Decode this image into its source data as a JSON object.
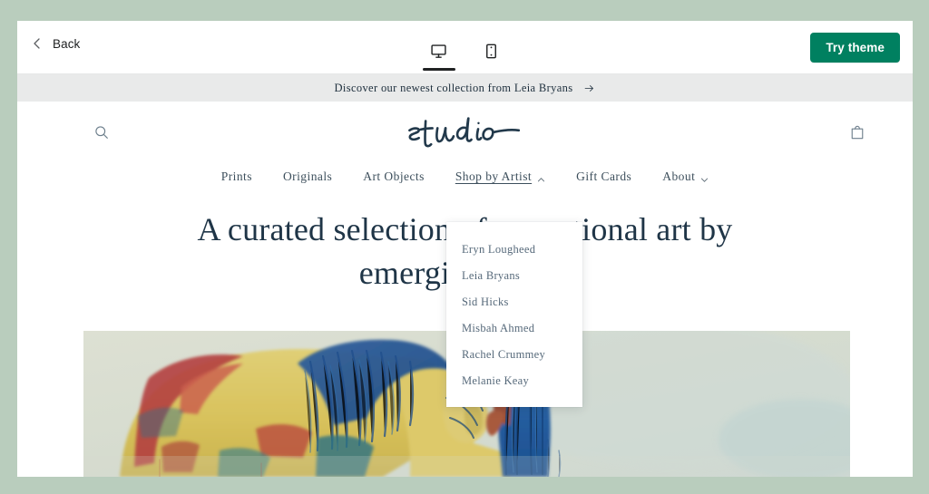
{
  "editor": {
    "back_label": "Back",
    "back_icon": "chevron-left-icon",
    "try_theme_label": "Try theme",
    "accent_color": "#008060",
    "devices": [
      {
        "name": "desktop",
        "icon": "desktop-icon",
        "selected": true
      },
      {
        "name": "mobile",
        "icon": "mobile-icon",
        "selected": false
      }
    ]
  },
  "storefront": {
    "background_color": "#ffffff",
    "stage_background_color": "#b9cdbd",
    "announcement": {
      "text": "Discover our newest collection from Leia Bryans",
      "icon": "arrow-right-icon",
      "background_color": "#e9eaea"
    },
    "header": {
      "logo_text": "studio",
      "search_icon": "search-icon",
      "cart_icon": "shopping-bag-icon"
    },
    "nav": [
      {
        "label": "Prints",
        "has_caret": false,
        "active": false
      },
      {
        "label": "Originals",
        "has_caret": false,
        "active": false
      },
      {
        "label": "Art Objects",
        "has_caret": false,
        "active": false
      },
      {
        "label": "Shop by Artist",
        "has_caret": true,
        "caret": "chevron-up-icon",
        "active": true
      },
      {
        "label": "Gift Cards",
        "has_caret": false,
        "active": false
      },
      {
        "label": "About",
        "has_caret": true,
        "caret": "chevron-down-icon",
        "active": false
      }
    ],
    "dropdown": {
      "open": true,
      "parent": "Shop by Artist",
      "items": [
        {
          "label": "Eryn Lougheed"
        },
        {
          "label": "Leia Bryans"
        },
        {
          "label": "Sid Hicks"
        },
        {
          "label": "Misbah Ahmed"
        },
        {
          "label": "Rachel Crummey"
        },
        {
          "label": "Melanie Keay"
        }
      ]
    },
    "hero": {
      "heading": "A curated selection of exceptional art by emerging artists",
      "heading_color": "#1f3547",
      "artwork_alt": "Expressionist watercolour painting of a horse beside a standing figure"
    }
  }
}
